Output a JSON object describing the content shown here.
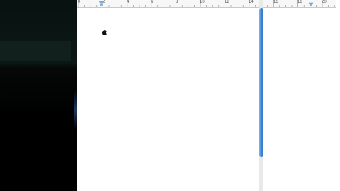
{
  "ruler": {
    "labels": [
      "0",
      "2",
      "4",
      "6",
      "8",
      "10",
      "12",
      "14",
      "16",
      "18",
      "20"
    ]
  },
  "document": {
    "content_icon": "apple-logo-icon"
  },
  "colors": {
    "accent_scroll": "#3e86d6",
    "desktop": "#0a1614",
    "page": "#ffffff"
  }
}
